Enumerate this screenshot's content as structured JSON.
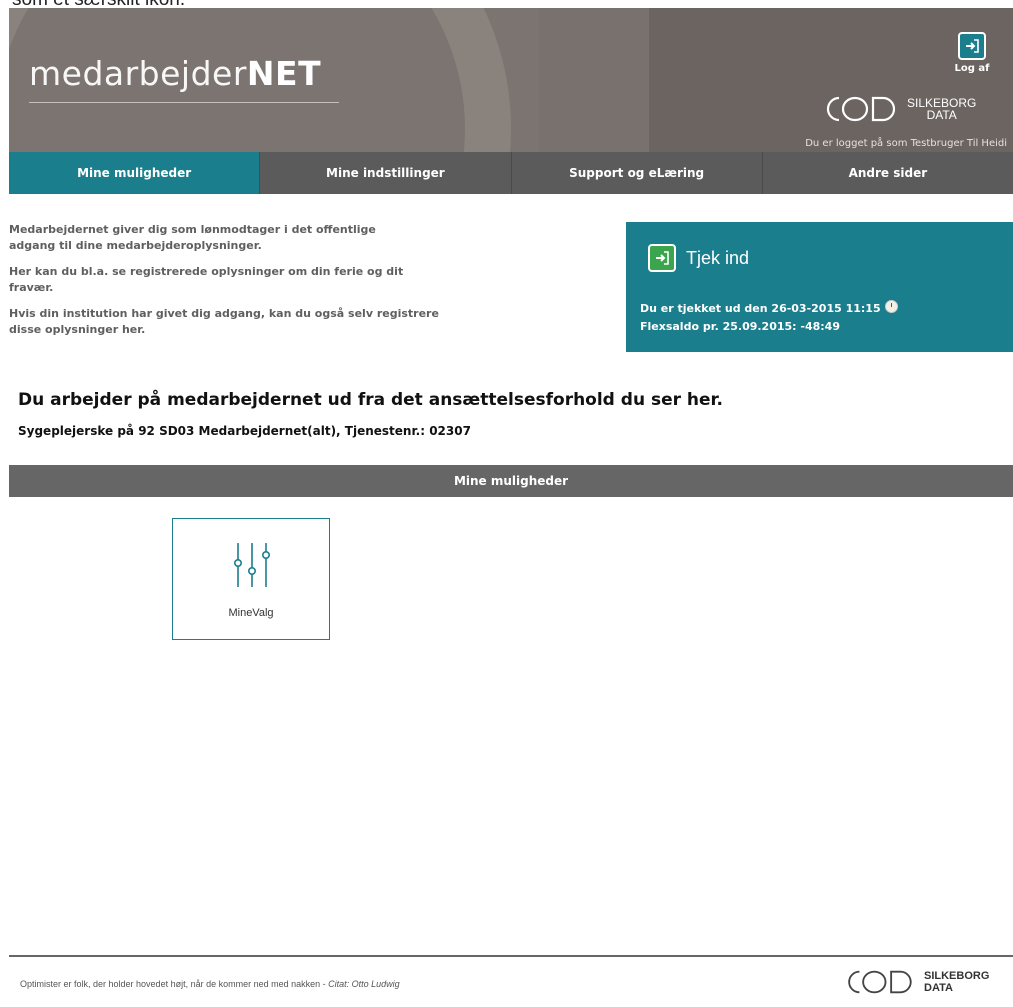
{
  "top_text": "som et særskilt ikon.",
  "header": {
    "logo_thin": "medarbejder",
    "logo_bold": "NET",
    "logout_label": "Log af",
    "brand_line1": "SILKEBORG",
    "brand_line2": "DATA",
    "logged_in_text": "Du er logget på som Testbruger Til Heidi"
  },
  "nav": {
    "tabs": [
      {
        "label": "Mine muligheder",
        "active": true
      },
      {
        "label": "Mine indstillinger",
        "active": false
      },
      {
        "label": "Support og eLæring",
        "active": false
      },
      {
        "label": "Andre sider",
        "active": false
      }
    ]
  },
  "intro": {
    "p1": "Medarbejdernet giver dig som lønmodtager i det offentlige adgang til dine medarbejderoplysninger.",
    "p2": "Her kan du bl.a. se registrerede oplysninger om din ferie og dit fravær.",
    "p3": "Hvis din institution har givet dig adgang, kan du også selv registrere disse oplysninger her."
  },
  "checkin": {
    "button_label": "Tjek ind",
    "status_line": "Du er tjekket ud den 26-03-2015 11:15",
    "flex_line": "Flexsaldo pr. 25.09.2015:  -48:49",
    "clock_icon": "clock-icon"
  },
  "employment": {
    "heading": "Du arbejder på medarbejdernet ud fra det ansættelsesforhold du ser her.",
    "detail": "Sygeplejerske på 92 SD03 Medarbejdernet(alt), Tjenestenr.: 02307"
  },
  "section": {
    "title": "Mine muligheder"
  },
  "tiles": [
    {
      "label": "MineValg",
      "icon": "sliders-icon"
    }
  ],
  "footer": {
    "quote": "Optimister er folk, der holder hovedet højt, når de kommer ned med nakken - ",
    "citation": "Citat: Otto Ludwig",
    "brand_line1": "SILKEBORG",
    "brand_line2": "DATA"
  },
  "colors": {
    "teal": "#1b7e8c",
    "nav_gray": "#5b5b5b",
    "header_gray": "#7c7470",
    "checkin_green": "#3ba54d"
  }
}
